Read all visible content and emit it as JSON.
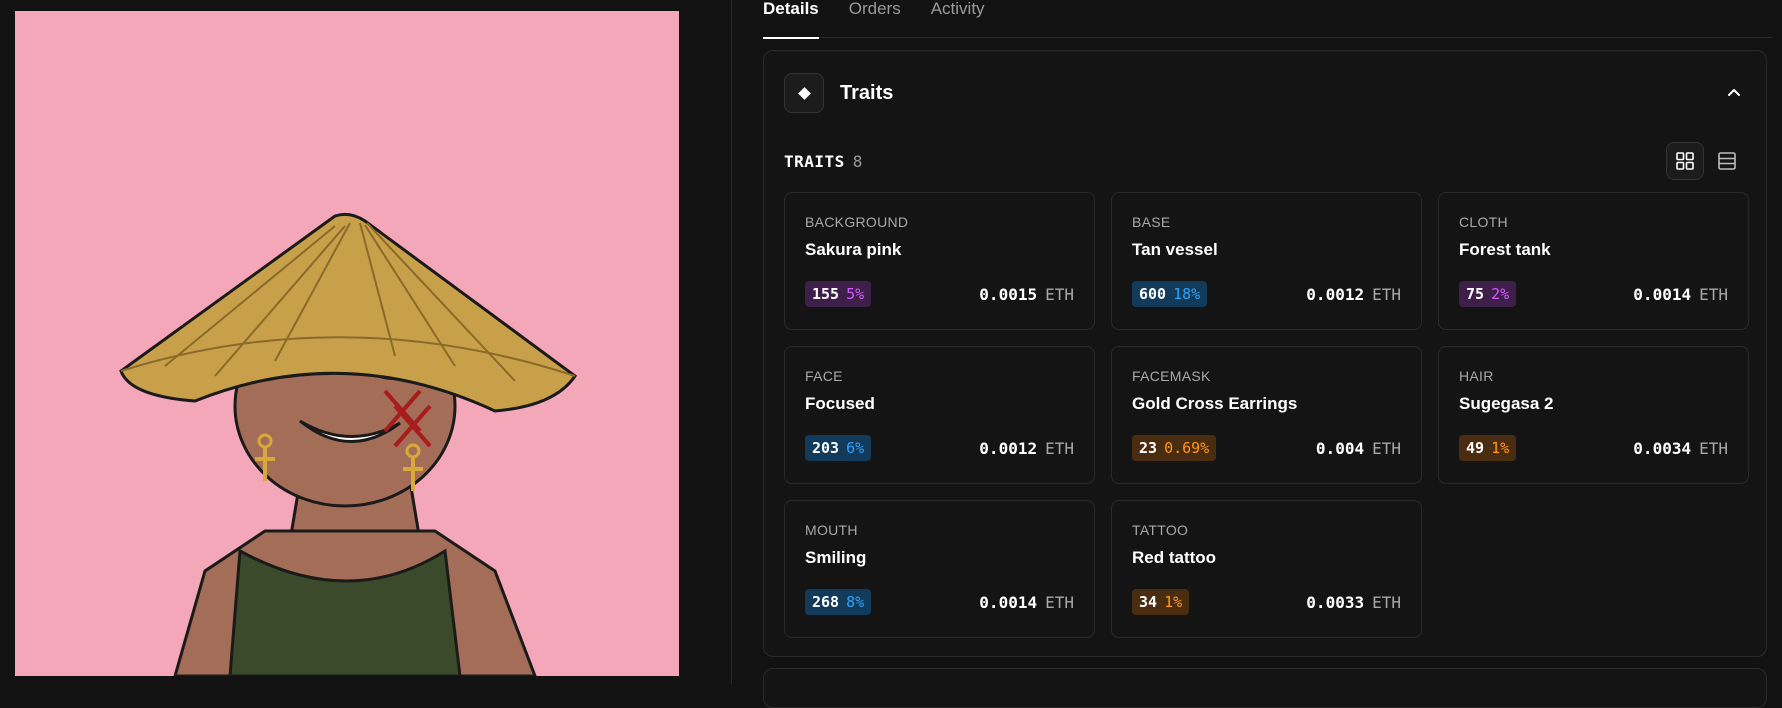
{
  "tabs": [
    {
      "label": "Details",
      "active": true
    },
    {
      "label": "Orders",
      "active": false
    },
    {
      "label": "Activity",
      "active": false
    }
  ],
  "panel": {
    "title": "Traits",
    "icon": "diamond-icon",
    "collapse_icon": "chevron-up-icon"
  },
  "traits_header": {
    "label": "TRAITS",
    "count": "8",
    "view_icons": [
      "grid-view-icon",
      "list-view-icon"
    ]
  },
  "traits": [
    {
      "type": "BACKGROUND",
      "value": "Sakura pink",
      "count": "155",
      "percent": "5%",
      "color": "purple",
      "price": "0.0015",
      "currency": "ETH"
    },
    {
      "type": "BASE",
      "value": "Tan vessel",
      "count": "600",
      "percent": "18%",
      "color": "blue",
      "price": "0.0012",
      "currency": "ETH"
    },
    {
      "type": "CLOTH",
      "value": "Forest tank",
      "count": "75",
      "percent": "2%",
      "color": "purple",
      "price": "0.0014",
      "currency": "ETH"
    },
    {
      "type": "FACE",
      "value": "Focused",
      "count": "203",
      "percent": "6%",
      "color": "blue",
      "price": "0.0012",
      "currency": "ETH"
    },
    {
      "type": "FACEMASK",
      "value": "Gold Cross Earrings",
      "count": "23",
      "percent": "0.69%",
      "color": "orange",
      "price": "0.004",
      "currency": "ETH"
    },
    {
      "type": "HAIR",
      "value": "Sugegasa 2",
      "count": "49",
      "percent": "1%",
      "color": "orange",
      "price": "0.0034",
      "currency": "ETH"
    },
    {
      "type": "MOUTH",
      "value": "Smiling",
      "count": "268",
      "percent": "8%",
      "color": "blue",
      "price": "0.0014",
      "currency": "ETH"
    },
    {
      "type": "TATTOO",
      "value": "Red tattoo",
      "count": "34",
      "percent": "1%",
      "color": "orange",
      "price": "0.0033",
      "currency": "ETH"
    }
  ],
  "colors": {
    "background": "#121212",
    "card_border": "#2a2a2a",
    "nft_background": "#f4a7b9",
    "purple_pct": "#d25cff",
    "blue_pct": "#2fa4ff",
    "orange_pct": "#ff9a1f"
  }
}
